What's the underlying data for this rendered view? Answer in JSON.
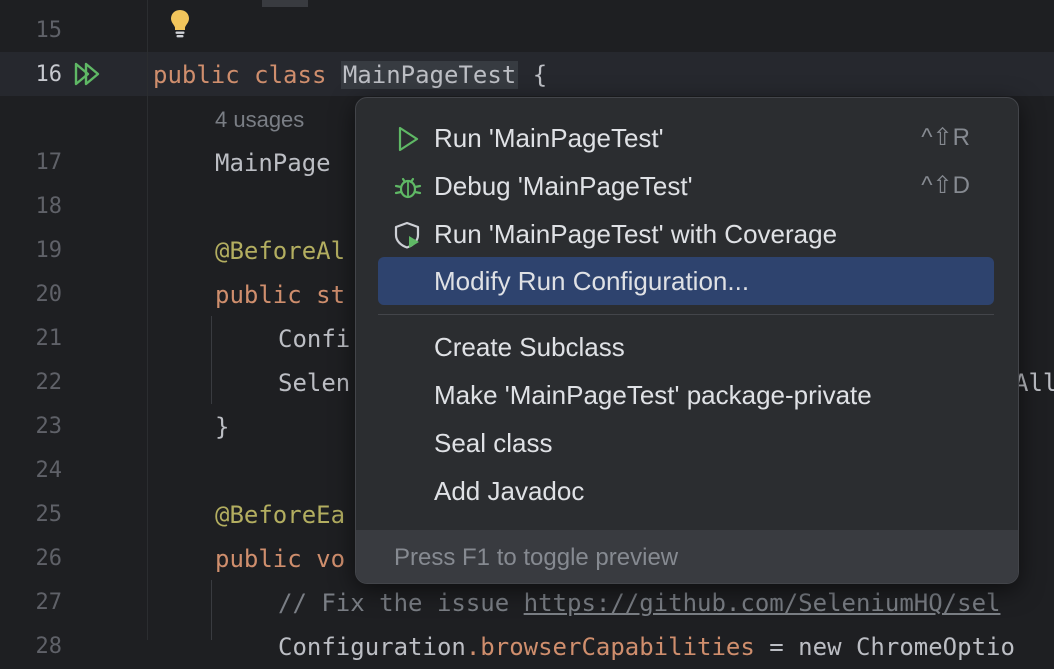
{
  "gutter": {
    "line_numbers": [
      "15",
      "16",
      "17",
      "18",
      "19",
      "20",
      "21",
      "22",
      "23",
      "24",
      "25",
      "26",
      "27",
      "28"
    ],
    "current_line": "16"
  },
  "code": {
    "line16": {
      "kw1": "public",
      "kw2": "class",
      "classname": "MainPageTest",
      "brace": "{"
    },
    "usages": "4 usages",
    "line17": "MainPage ",
    "line19": "@BeforeAl",
    "line20": {
      "kw": "public",
      "rest": "st"
    },
    "line21": "Confi",
    "line22": "Selen",
    "line22_right": "All",
    "line23": "}",
    "line25": "@BeforeEa",
    "line26": {
      "kw": "public",
      "rest": "vo"
    },
    "line27": {
      "comment": "// Fix the issue ",
      "link": "https://github.com/SeleniumHQ/sel"
    },
    "line28": {
      "a": "Configuration",
      "b": ".browserCapabilities",
      "c": " = new ChromeOptio"
    }
  },
  "popup": {
    "items": [
      {
        "label": "Run 'MainPageTest'",
        "shortcut": "^⇧R",
        "icon": "run-icon"
      },
      {
        "label": "Debug 'MainPageTest'",
        "shortcut": "^⇧D",
        "icon": "debug-icon"
      },
      {
        "label": "Run 'MainPageTest' with Coverage",
        "shortcut": "",
        "icon": "coverage-icon"
      },
      {
        "label": "Modify Run Configuration...",
        "shortcut": "",
        "icon": ""
      },
      {
        "label": "Create Subclass",
        "shortcut": "",
        "icon": ""
      },
      {
        "label": "Make 'MainPageTest' package-private",
        "shortcut": "",
        "icon": ""
      },
      {
        "label": "Seal class",
        "shortcut": "",
        "icon": ""
      },
      {
        "label": "Add Javadoc",
        "shortcut": "",
        "icon": ""
      }
    ],
    "selected_index": 3,
    "footer": "Press F1 to toggle preview"
  },
  "colors": {
    "background": "#1e1f22",
    "popup_bg": "#2b2d30",
    "selection": "#2e436e",
    "keyword": "#cf8e6d",
    "annotation": "#b3ae60",
    "run_green": "#5fb865"
  }
}
